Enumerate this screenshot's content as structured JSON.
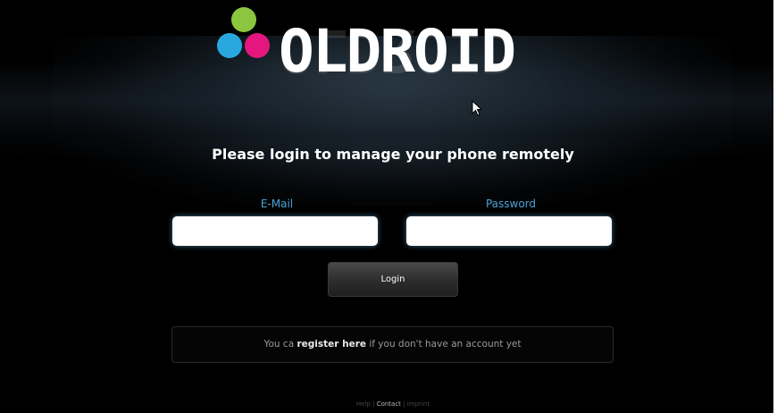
{
  "logo": {
    "text": "OLDROID",
    "dot_colors": {
      "green": "#8cc63f",
      "blue": "#29a8e0",
      "pink": "#e5177e"
    }
  },
  "headline": "Please login to manage your phone remotely",
  "form": {
    "email_label": "E-Mail",
    "email_value": "",
    "password_label": "Password",
    "password_value": "",
    "login_label": "Login"
  },
  "register": {
    "prefix": "You ca ",
    "link_text": "register here",
    "suffix": " if you don't have an account yet"
  },
  "footer": {
    "links": [
      "Help",
      "Contact",
      "Imprint"
    ],
    "separator": " | "
  },
  "colors": {
    "label_blue": "#4aa3d8",
    "background": "#000000"
  }
}
